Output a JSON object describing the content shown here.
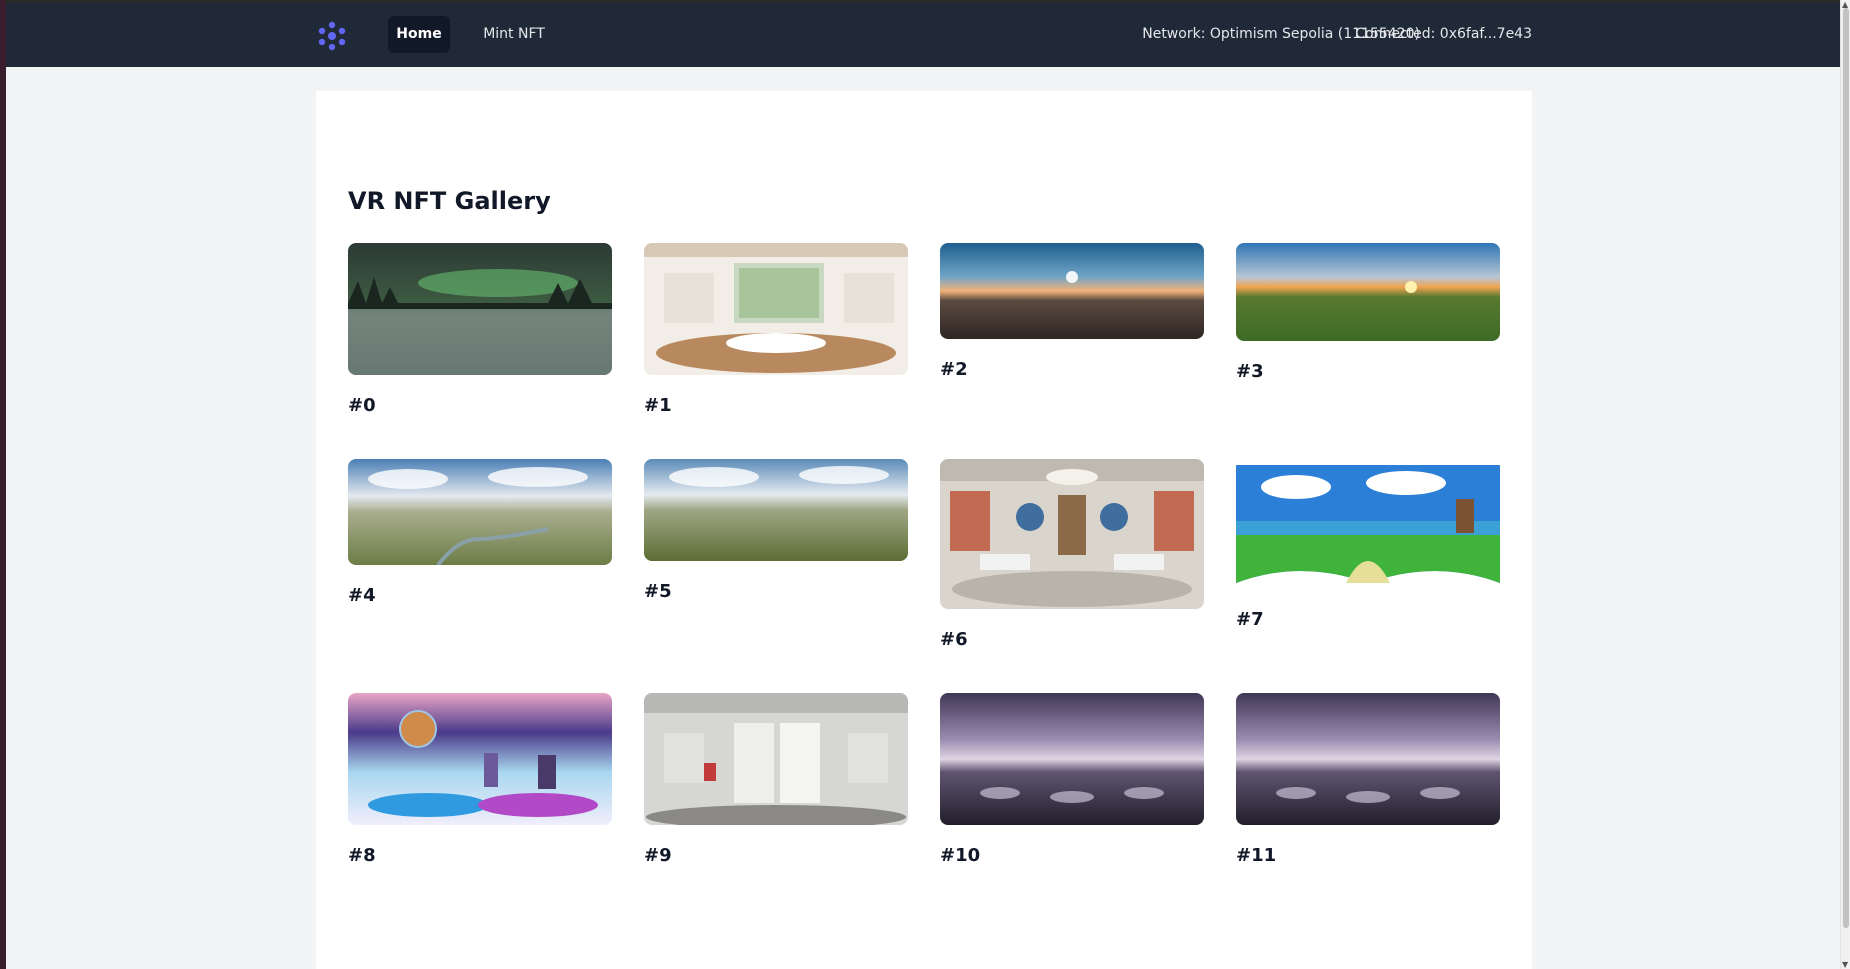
{
  "nav": {
    "home_label": "Home",
    "mint_label": "Mint NFT",
    "network_text": "Network: Optimism Sepolia (11155420)",
    "connected_text": "Connected: 0x6faf...7e43",
    "logo_icon": "dots-flower-logo-icon",
    "logo_color": "#6366f1"
  },
  "gallery": {
    "title": "VR NFT Gallery",
    "items": [
      {
        "label": "#0",
        "scene": "aurora-snow"
      },
      {
        "label": "#1",
        "scene": "bright-living-room"
      },
      {
        "label": "#2",
        "scene": "sunrise-aerial-city"
      },
      {
        "label": "#3",
        "scene": "sunset-green-hills"
      },
      {
        "label": "#4",
        "scene": "cloudy-aerial-river"
      },
      {
        "label": "#5",
        "scene": "cloudy-aerial-fields"
      },
      {
        "label": "#6",
        "scene": "anatomy-classroom"
      },
      {
        "label": "#7",
        "scene": "cartoon-island"
      },
      {
        "label": "#8",
        "scene": "fantasy-space-mechs"
      },
      {
        "label": "#9",
        "scene": "white-hallway-rooms"
      },
      {
        "label": "#10",
        "scene": "purple-futuristic-city"
      },
      {
        "label": "#11",
        "scene": "purple-futuristic-city"
      }
    ]
  }
}
